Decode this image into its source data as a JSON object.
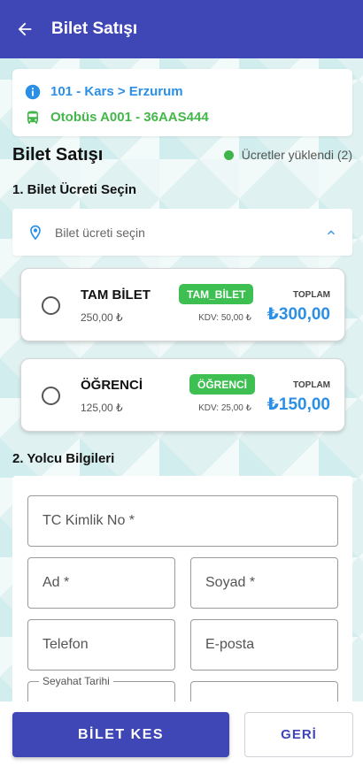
{
  "appbar": {
    "title": "Bilet Satışı"
  },
  "route": {
    "line": "101 - Kars > Erzurum",
    "vehicle": "Otobüs A001 - 36AAS444"
  },
  "section": {
    "title": "Bilet Satışı",
    "status": "Ücretler yüklendi (2)"
  },
  "step1": {
    "title": "1. Bilet Ücreti Seçin",
    "select_label": "Bilet ücreti seçin"
  },
  "fares": [
    {
      "name": "TAM BİLET",
      "badge": "TAM_BİLET",
      "price": "250,00 ₺",
      "kdv": "KDV: 50,00 ₺",
      "total_label": "TOPLAM",
      "total": "₺300,00"
    },
    {
      "name": "ÖĞRENCİ",
      "badge": "ÖĞRENCİ",
      "price": "125,00 ₺",
      "kdv": "KDV: 25,00 ₺",
      "total_label": "TOPLAM",
      "total": "₺150,00"
    }
  ],
  "step2": {
    "title": "2. Yolcu Bilgileri",
    "tc_placeholder": "TC Kimlik No *",
    "name_placeholder": "Ad *",
    "surname_placeholder": "Soyad *",
    "phone_placeholder": "Telefon",
    "email_placeholder": "E-posta",
    "travel_date_label": "Seyahat Tarihi"
  },
  "actions": {
    "primary": "BİLET KES",
    "secondary": "GERİ"
  },
  "colors": {
    "primary": "#3f46b5",
    "info_blue": "#2c8fe6",
    "success_green": "#43b74a"
  }
}
